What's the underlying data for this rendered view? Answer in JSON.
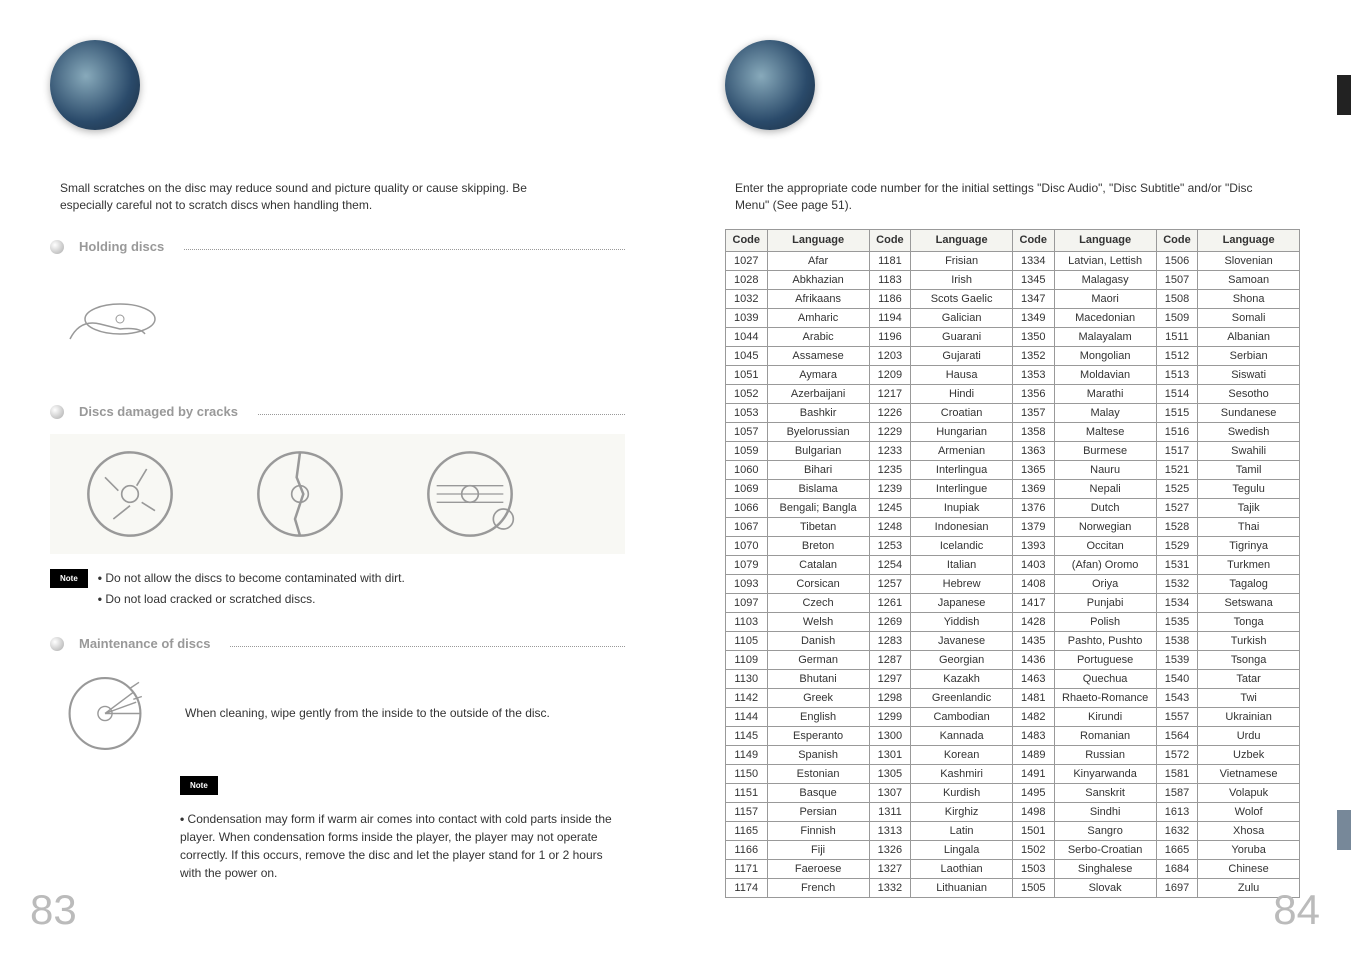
{
  "left_page": {
    "intro": "Small scratches on the disc may reduce sound and picture quality or cause skipping. Be especially careful not to scratch discs when handling them.",
    "sec1_title": "Holding discs",
    "sec2_title": "Discs damaged by cracks",
    "note1_label": "Note",
    "note1_items": [
      "Do not allow the discs to become contaminated with dirt.",
      "Do not load cracked or scratched discs."
    ],
    "sec3_title": "Maintenance of discs",
    "clean_text": "When cleaning, wipe gently from the inside to the outside of the disc.",
    "note2_label": "Note",
    "note2_text": "Condensation may form if warm air comes into contact with cold parts inside the player. When condensation forms inside the player, the player may not operate correctly. If this occurs, remove the disc and let the player stand for 1 or 2 hours with the power on.",
    "page_num": "83"
  },
  "right_page": {
    "intro": "Enter the appropriate code number for the initial settings \"Disc Audio\", \"Disc Subtitle\" and/or \"Disc Menu\" (See page 51).",
    "headers": [
      "Code",
      "Language",
      "Code",
      "Language",
      "Code",
      "Language",
      "Code",
      "Language"
    ],
    "rows": [
      [
        "1027",
        "Afar",
        "1181",
        "Frisian",
        "1334",
        "Latvian, Lettish",
        "1506",
        "Slovenian"
      ],
      [
        "1028",
        "Abkhazian",
        "1183",
        "Irish",
        "1345",
        "Malagasy",
        "1507",
        "Samoan"
      ],
      [
        "1032",
        "Afrikaans",
        "1186",
        "Scots Gaelic",
        "1347",
        "Maori",
        "1508",
        "Shona"
      ],
      [
        "1039",
        "Amharic",
        "1194",
        "Galician",
        "1349",
        "Macedonian",
        "1509",
        "Somali"
      ],
      [
        "1044",
        "Arabic",
        "1196",
        "Guarani",
        "1350",
        "Malayalam",
        "1511",
        "Albanian"
      ],
      [
        "1045",
        "Assamese",
        "1203",
        "Gujarati",
        "1352",
        "Mongolian",
        "1512",
        "Serbian"
      ],
      [
        "1051",
        "Aymara",
        "1209",
        "Hausa",
        "1353",
        "Moldavian",
        "1513",
        "Siswati"
      ],
      [
        "1052",
        "Azerbaijani",
        "1217",
        "Hindi",
        "1356",
        "Marathi",
        "1514",
        "Sesotho"
      ],
      [
        "1053",
        "Bashkir",
        "1226",
        "Croatian",
        "1357",
        "Malay",
        "1515",
        "Sundanese"
      ],
      [
        "1057",
        "Byelorussian",
        "1229",
        "Hungarian",
        "1358",
        "Maltese",
        "1516",
        "Swedish"
      ],
      [
        "1059",
        "Bulgarian",
        "1233",
        "Armenian",
        "1363",
        "Burmese",
        "1517",
        "Swahili"
      ],
      [
        "1060",
        "Bihari",
        "1235",
        "Interlingua",
        "1365",
        "Nauru",
        "1521",
        "Tamil"
      ],
      [
        "1069",
        "Bislama",
        "1239",
        "Interlingue",
        "1369",
        "Nepali",
        "1525",
        "Tegulu"
      ],
      [
        "1066",
        "Bengali; Bangla",
        "1245",
        "Inupiak",
        "1376",
        "Dutch",
        "1527",
        "Tajik"
      ],
      [
        "1067",
        "Tibetan",
        "1248",
        "Indonesian",
        "1379",
        "Norwegian",
        "1528",
        "Thai"
      ],
      [
        "1070",
        "Breton",
        "1253",
        "Icelandic",
        "1393",
        "Occitan",
        "1529",
        "Tigrinya"
      ],
      [
        "1079",
        "Catalan",
        "1254",
        "Italian",
        "1403",
        "(Afan) Oromo",
        "1531",
        "Turkmen"
      ],
      [
        "1093",
        "Corsican",
        "1257",
        "Hebrew",
        "1408",
        "Oriya",
        "1532",
        "Tagalog"
      ],
      [
        "1097",
        "Czech",
        "1261",
        "Japanese",
        "1417",
        "Punjabi",
        "1534",
        "Setswana"
      ],
      [
        "1103",
        "Welsh",
        "1269",
        "Yiddish",
        "1428",
        "Polish",
        "1535",
        "Tonga"
      ],
      [
        "1105",
        "Danish",
        "1283",
        "Javanese",
        "1435",
        "Pashto, Pushto",
        "1538",
        "Turkish"
      ],
      [
        "1109",
        "German",
        "1287",
        "Georgian",
        "1436",
        "Portuguese",
        "1539",
        "Tsonga"
      ],
      [
        "1130",
        "Bhutani",
        "1297",
        "Kazakh",
        "1463",
        "Quechua",
        "1540",
        "Tatar"
      ],
      [
        "1142",
        "Greek",
        "1298",
        "Greenlandic",
        "1481",
        "Rhaeto-Romance",
        "1543",
        "Twi"
      ],
      [
        "1144",
        "English",
        "1299",
        "Cambodian",
        "1482",
        "Kirundi",
        "1557",
        "Ukrainian"
      ],
      [
        "1145",
        "Esperanto",
        "1300",
        "Kannada",
        "1483",
        "Romanian",
        "1564",
        "Urdu"
      ],
      [
        "1149",
        "Spanish",
        "1301",
        "Korean",
        "1489",
        "Russian",
        "1572",
        "Uzbek"
      ],
      [
        "1150",
        "Estonian",
        "1305",
        "Kashmiri",
        "1491",
        "Kinyarwanda",
        "1581",
        "Vietnamese"
      ],
      [
        "1151",
        "Basque",
        "1307",
        "Kurdish",
        "1495",
        "Sanskrit",
        "1587",
        "Volapuk"
      ],
      [
        "1157",
        "Persian",
        "1311",
        "Kirghiz",
        "1498",
        "Sindhi",
        "1613",
        "Wolof"
      ],
      [
        "1165",
        "Finnish",
        "1313",
        "Latin",
        "1501",
        "Sangro",
        "1632",
        "Xhosa"
      ],
      [
        "1166",
        "Fiji",
        "1326",
        "Lingala",
        "1502",
        "Serbo-Croatian",
        "1665",
        "Yoruba"
      ],
      [
        "1171",
        "Faeroese",
        "1327",
        "Laothian",
        "1503",
        "Singhalese",
        "1684",
        "Chinese"
      ],
      [
        "1174",
        "French",
        "1332",
        "Lithuanian",
        "1505",
        "Slovak",
        "1697",
        "Zulu"
      ]
    ],
    "page_num": "84"
  }
}
